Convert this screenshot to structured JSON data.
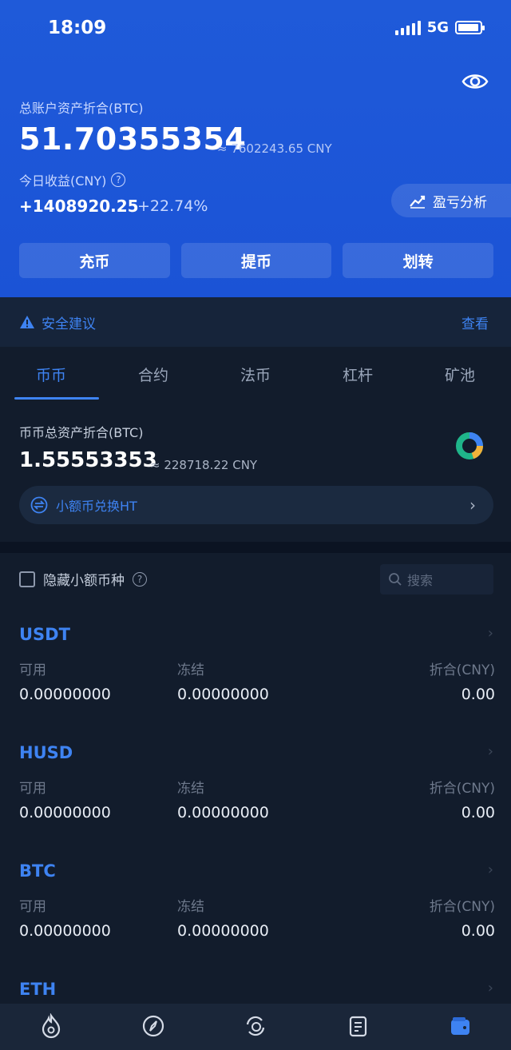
{
  "status_bar": {
    "time": "18:09",
    "network": "5G",
    "battery_level": 0.95
  },
  "header": {
    "total_label": "总账户资产折合(BTC)",
    "total_value": "51.70355354",
    "total_cny": "≈ 7602243.65 CNY",
    "today_label": "今日收益(CNY)",
    "help_icon": "?",
    "today_value": "+1408920.25",
    "today_pct": "+22.74%",
    "pnl_label": "盈亏分析",
    "actions": [
      "充币",
      "提币",
      "划转"
    ]
  },
  "security": {
    "label": "安全建议",
    "link": "查看"
  },
  "tabs": [
    "币币",
    "合约",
    "法币",
    "杠杆",
    "矿池"
  ],
  "spot": {
    "label": "币币总资产折合(BTC)",
    "value": "1.55553353",
    "cny": "≈ 228718.22 CNY",
    "convert_label": "小额币兑换HT"
  },
  "filter": {
    "hide_label": "隐藏小额币种",
    "help_icon": "?",
    "search_placeholder": "搜索"
  },
  "columns": {
    "available": "可用",
    "frozen": "冻结",
    "cny": "折合(CNY)"
  },
  "coins": [
    {
      "name": "USDT",
      "available": "0.00000000",
      "frozen": "0.00000000",
      "cny": "0.00"
    },
    {
      "name": "HUSD",
      "available": "0.00000000",
      "frozen": "0.00000000",
      "cny": "0.00"
    },
    {
      "name": "BTC",
      "available": "0.00000000",
      "frozen": "0.00000000",
      "cny": "0.00"
    },
    {
      "name": "ETH"
    }
  ],
  "colors": {
    "brand_blue": "#1f5ad9",
    "accent": "#3e83f2",
    "background": "#121c2c"
  },
  "nav_icons": [
    "flame-icon",
    "compass-icon",
    "exchange-icon",
    "orders-icon",
    "wallet-icon"
  ]
}
